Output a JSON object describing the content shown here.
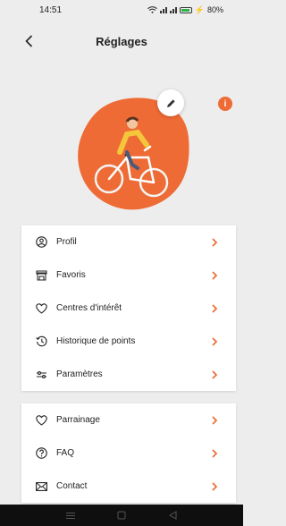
{
  "status": {
    "time": "14:51",
    "battery": "80%"
  },
  "header": {
    "title": "Réglages"
  },
  "hero": {
    "info": "i"
  },
  "menu_main": [
    {
      "label": "Profil",
      "icon": "user-circle-icon"
    },
    {
      "label": "Favoris",
      "icon": "storefront-icon"
    },
    {
      "label": "Centres d'intérêt",
      "icon": "heart-outline-icon"
    },
    {
      "label": "Historique de points",
      "icon": "history-icon"
    },
    {
      "label": "Paramètres",
      "icon": "sliders-icon"
    }
  ],
  "menu_secondary": [
    {
      "label": "Parrainage",
      "icon": "heart-outline-icon"
    },
    {
      "label": "FAQ",
      "icon": "question-circle-icon"
    },
    {
      "label": "Contact",
      "icon": "mail-icon"
    }
  ],
  "colors": {
    "accent": "#ee6b35",
    "background": "#ededed",
    "card": "#ffffff"
  }
}
